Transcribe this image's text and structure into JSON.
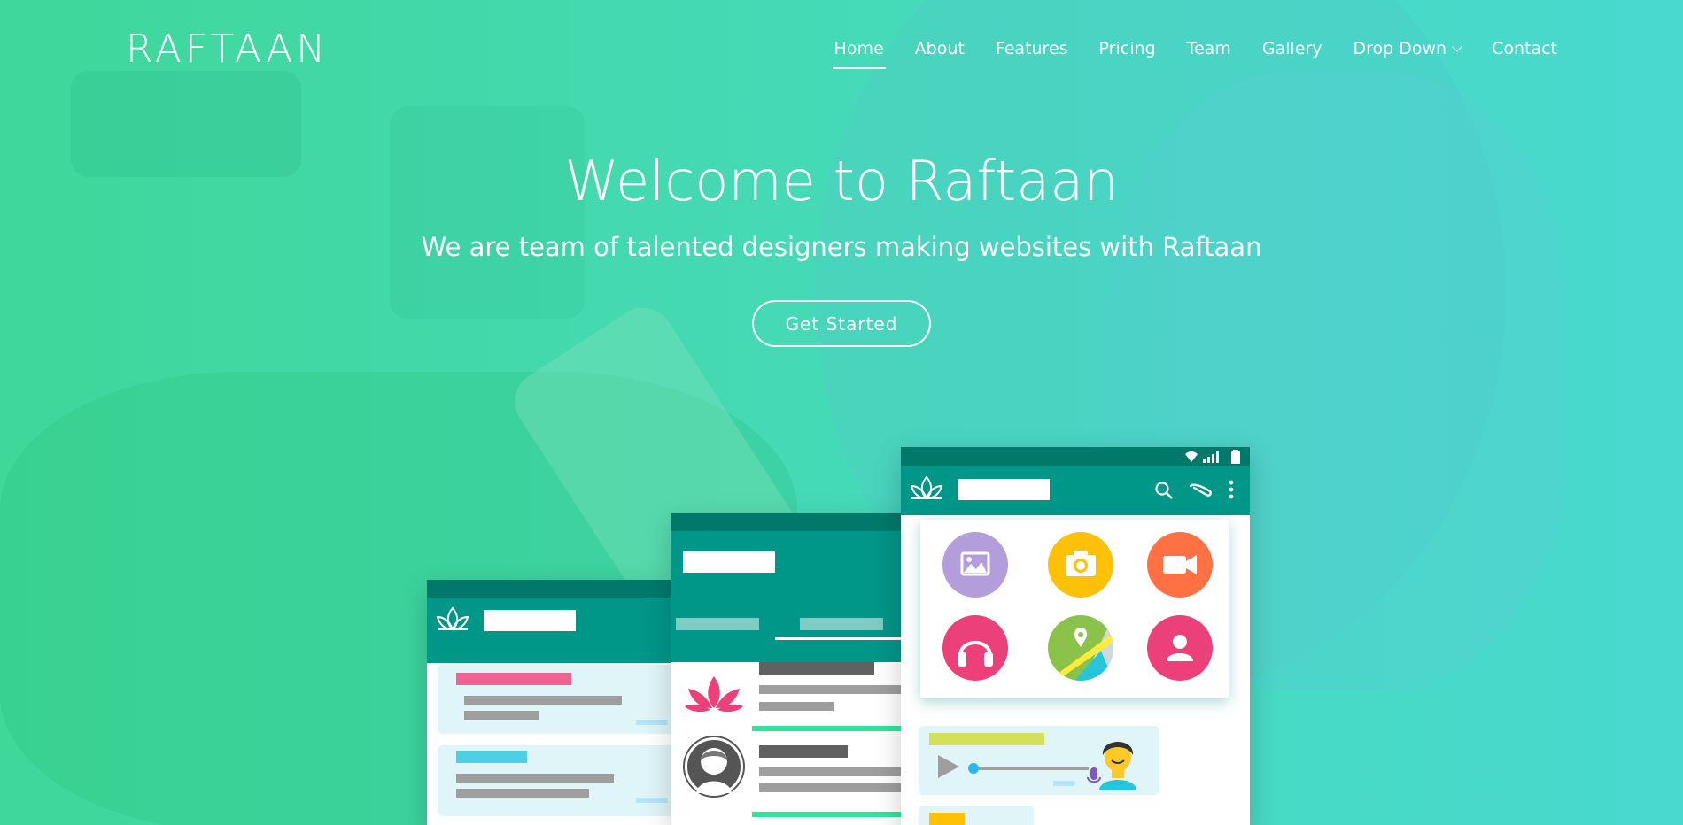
{
  "brand": {
    "logo": "RAFTAAN"
  },
  "nav": {
    "items": [
      "Home",
      "About",
      "Features",
      "Pricing",
      "Team",
      "Gallery",
      "Drop Down",
      "Contact"
    ],
    "active": "Home"
  },
  "hero": {
    "title": "Welcome to Raftaan",
    "subtitle": "We are team of talented designers making websites with Raftaan",
    "cta": "Get Started"
  },
  "colors": {
    "primary": "#009688",
    "dark_primary": "#00796b",
    "accent_green": "#2ee59d"
  },
  "icons": [
    "chevron-down-icon",
    "lotus-icon",
    "search-icon",
    "attach-icon",
    "more-vertical-icon",
    "wifi-icon",
    "signal-icon",
    "battery-icon",
    "gallery-icon",
    "camera-icon",
    "video-icon",
    "headphones-icon",
    "location-icon",
    "contact-icon",
    "play-icon",
    "microphone-icon"
  ]
}
